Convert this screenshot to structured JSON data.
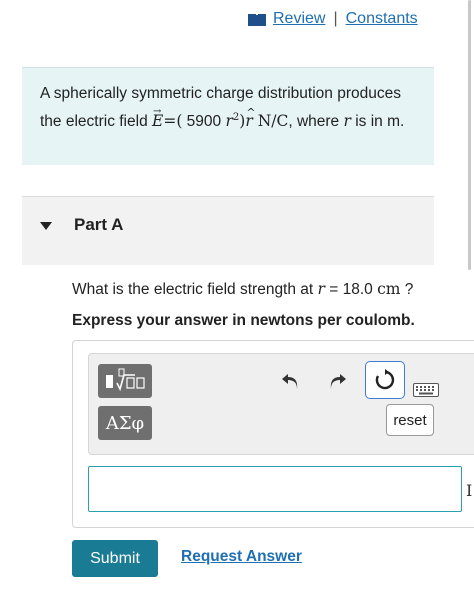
{
  "header": {
    "review_label": "Review",
    "separator": "|",
    "constants_label": "Constants"
  },
  "problem": {
    "text_1": "A spherically symmetric charge distribution produces the electric field ",
    "E_symbol": "E",
    "equals": "=(",
    "coefficient": " 5900 ",
    "r_symbol": "r",
    "exponent": "2",
    "close_paren": ")",
    "rhat_symbol": "r",
    "units": " N/C",
    "text_2": ", where ",
    "r_symbol_2": "r",
    "text_3": " is in m."
  },
  "part": {
    "title": "Part A"
  },
  "question": {
    "text_before": "What is the electric field strength at ",
    "r_symbol": "r",
    "equals": " = 18.0 ",
    "unit": "cm",
    "question_mark": " ?"
  },
  "instruction": "Express your answer in newtons per coulomb.",
  "toolbar": {
    "greek_label": "ΑΣφ",
    "reset_label": "reset"
  },
  "answer": {
    "value": "",
    "side_marker": "I"
  },
  "buttons": {
    "submit_label": "Submit",
    "request_answer_label": "Request Answer"
  },
  "icons": [
    "book-icon",
    "templates-icon",
    "undo-icon",
    "redo-icon",
    "reset-icon",
    "keyboard-icon",
    "expand-triangle-icon"
  ]
}
